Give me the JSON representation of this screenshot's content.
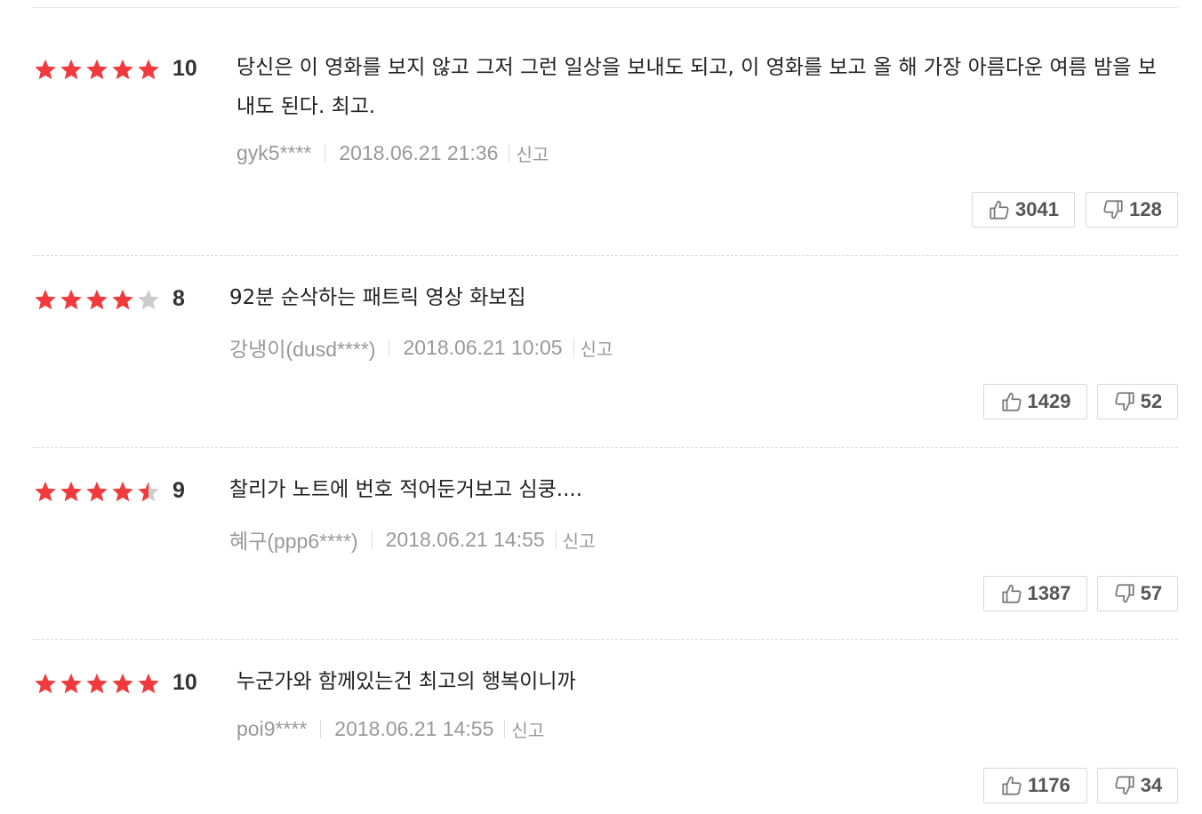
{
  "colors": {
    "star_on": "#f23a3c",
    "star_off": "#cccccc",
    "meta_text": "#999999",
    "button_border": "#d9d9d9"
  },
  "icons": {
    "like": "thumbs-up-icon",
    "dislike": "thumbs-down-icon",
    "star": "star-icon"
  },
  "reviews": [
    {
      "stars": [
        1,
        1,
        1,
        1,
        1
      ],
      "score": "10",
      "text": "당신은 이 영화를 보지 않고 그저 그런 일상을 보내도 되고, 이 영화를 보고 올 해 가장 아름다운 여름 밤을 보내도 된다. 최고.",
      "author": "gyk5****",
      "date": "2018.06.21 21:36",
      "report": "신고",
      "likes": "3041",
      "dislikes": "128"
    },
    {
      "stars": [
        1,
        1,
        1,
        1,
        0
      ],
      "score": "8",
      "text": "92분 순삭하는 패트릭 영상 화보집",
      "author": "강냉이(dusd****)",
      "date": "2018.06.21 10:05",
      "report": "신고",
      "likes": "1429",
      "dislikes": "52"
    },
    {
      "stars": [
        1,
        1,
        1,
        1,
        0.5
      ],
      "score": "9",
      "text": "찰리가 노트에 번호 적어둔거보고 심쿵....",
      "author": "혜구(ppp6****)",
      "date": "2018.06.21 14:55",
      "report": "신고",
      "likes": "1387",
      "dislikes": "57"
    },
    {
      "stars": [
        1,
        1,
        1,
        1,
        1
      ],
      "score": "10",
      "text": "누군가와 함께있는건 최고의 행복이니까",
      "author": "poi9****",
      "date": "2018.06.21 14:55",
      "report": "신고",
      "likes": "1176",
      "dislikes": "34"
    }
  ]
}
